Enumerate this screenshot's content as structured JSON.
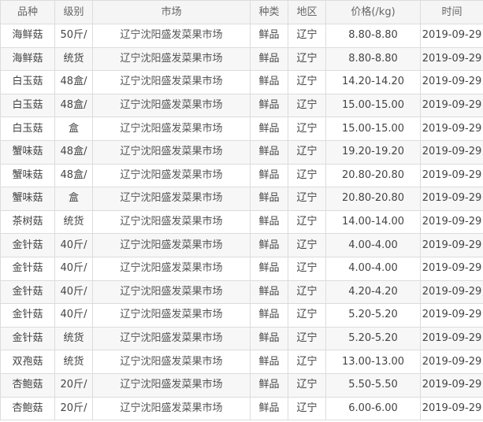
{
  "table": {
    "headers": [
      "品种",
      "级别",
      "市场",
      "种类",
      "地区",
      "价格(/kg)",
      "时间"
    ],
    "rows": [
      [
        "海鲜菇",
        "50斤/",
        "辽宁沈阳盛发菜果市场",
        "鲜品",
        "辽宁",
        "8.80-8.80",
        "2019-09-29"
      ],
      [
        "海鲜菇",
        "统货",
        "辽宁沈阳盛发菜果市场",
        "鲜品",
        "辽宁",
        "8.80-8.80",
        "2019-09-29"
      ],
      [
        "白玉菇",
        "48盒/",
        "辽宁沈阳盛发菜果市场",
        "鲜品",
        "辽宁",
        "14.20-14.20",
        "2019-09-29"
      ],
      [
        "白玉菇",
        "48盒/",
        "辽宁沈阳盛发菜果市场",
        "鲜品",
        "辽宁",
        "15.00-15.00",
        "2019-09-29"
      ],
      [
        "白玉菇",
        "盒",
        "辽宁沈阳盛发菜果市场",
        "鲜品",
        "辽宁",
        "15.00-15.00",
        "2019-09-29"
      ],
      [
        "蟹味菇",
        "48盒/",
        "辽宁沈阳盛发菜果市场",
        "鲜品",
        "辽宁",
        "19.20-19.20",
        "2019-09-29"
      ],
      [
        "蟹味菇",
        "48盒/",
        "辽宁沈阳盛发菜果市场",
        "鲜品",
        "辽宁",
        "20.80-20.80",
        "2019-09-29"
      ],
      [
        "蟹味菇",
        "盒",
        "辽宁沈阳盛发菜果市场",
        "鲜品",
        "辽宁",
        "20.80-20.80",
        "2019-09-29"
      ],
      [
        "茶树菇",
        "统货",
        "辽宁沈阳盛发菜果市场",
        "鲜品",
        "辽宁",
        "14.00-14.00",
        "2019-09-29"
      ],
      [
        "金针菇",
        "40斤/",
        "辽宁沈阳盛发菜果市场",
        "鲜品",
        "辽宁",
        "4.00-4.00",
        "2019-09-29"
      ],
      [
        "金针菇",
        "40斤/",
        "辽宁沈阳盛发菜果市场",
        "鲜品",
        "辽宁",
        "4.00-4.00",
        "2019-09-29"
      ],
      [
        "金针菇",
        "40斤/",
        "辽宁沈阳盛发菜果市场",
        "鲜品",
        "辽宁",
        "4.20-4.20",
        "2019-09-29"
      ],
      [
        "金针菇",
        "40斤/",
        "辽宁沈阳盛发菜果市场",
        "鲜品",
        "辽宁",
        "5.20-5.20",
        "2019-09-29"
      ],
      [
        "金针菇",
        "统货",
        "辽宁沈阳盛发菜果市场",
        "鲜品",
        "辽宁",
        "5.20-5.20",
        "2019-09-29"
      ],
      [
        "双孢菇",
        "统货",
        "辽宁沈阳盛发菜果市场",
        "鲜品",
        "辽宁",
        "13.00-13.00",
        "2019-09-29"
      ],
      [
        "杏鲍菇",
        "20斤/",
        "辽宁沈阳盛发菜果市场",
        "鲜品",
        "辽宁",
        "5.50-5.50",
        "2019-09-29"
      ],
      [
        "杏鲍菇",
        "20斤/",
        "辽宁沈阳盛发菜果市场",
        "鲜品",
        "辽宁",
        "6.00-6.00",
        "2019-09-29"
      ]
    ]
  }
}
